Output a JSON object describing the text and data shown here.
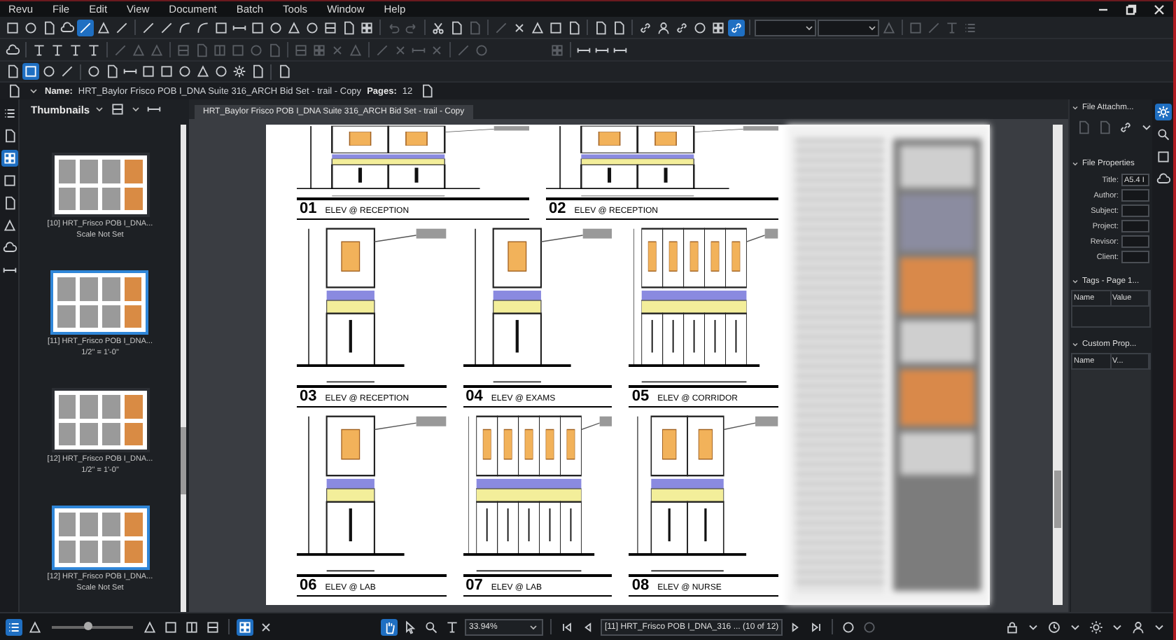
{
  "menu": [
    "Revu",
    "File",
    "Edit",
    "View",
    "Document",
    "Batch",
    "Tools",
    "Window",
    "Help"
  ],
  "file_info": {
    "name_label": "Name:",
    "name": "HRT_Baylor Frisco POB I_DNA Suite 316_ARCH Bid Set - trail - Copy",
    "pages_label": "Pages:",
    "pages": "12"
  },
  "thumbnails": {
    "title": "Thumbnails",
    "items": [
      {
        "label": "[10] HRT_Frisco POB I_DNA...",
        "scale": "Scale Not Set",
        "selected": false
      },
      {
        "label": "[11] HRT_Frisco POB I_DNA...",
        "scale": "1/2\" = 1'-0\"",
        "selected": true
      },
      {
        "label": "[12] HRT_Frisco POB I_DNA...",
        "scale": "1/2\" = 1'-0\"",
        "selected": false
      },
      {
        "label": "[12] HRT_Frisco POB I_DNA...",
        "scale": "Scale Not Set",
        "selected": true
      }
    ]
  },
  "document": {
    "tab": "HRT_Baylor Frisco POB I_DNA Suite 316_ARCH Bid Set - trail - Copy",
    "elevation_rows": [
      [
        {
          "number": "01",
          "title": "ELEV @ RECEPTION"
        },
        {
          "number": "02",
          "title": "ELEV @ RECEPTION"
        }
      ],
      [
        {
          "number": "03",
          "title": "ELEV @ RECEPTION"
        },
        {
          "number": "04",
          "title": "ELEV @ EXAMS"
        },
        {
          "number": "05",
          "title": "ELEV @ CORRIDOR"
        }
      ],
      [
        {
          "number": "06",
          "title": "ELEV @ LAB"
        },
        {
          "number": "07",
          "title": "ELEV @ LAB"
        },
        {
          "number": "08",
          "title": "ELEV @ NURSE"
        }
      ]
    ]
  },
  "right_panel": {
    "attachments": {
      "title": "File Attachm..."
    },
    "properties": {
      "title": "File Properties",
      "fields": [
        {
          "label": "Title:",
          "value": "A5.4 I"
        },
        {
          "label": "Author:"
        },
        {
          "label": "Subject:"
        },
        {
          "label": "Project:"
        },
        {
          "label": "Revisor:"
        },
        {
          "label": "Client:"
        }
      ]
    },
    "tags": {
      "title": "Tags - Page 1...",
      "columns": [
        "Name",
        "Value"
      ]
    },
    "custom": {
      "title": "Custom Prop...",
      "columns": [
        "Name",
        "V..."
      ]
    }
  },
  "status_bar": {
    "thumbnail_size": {
      "level": 0.45
    },
    "zoom": "33.94%",
    "page": "[11] HRT_Frisco POB I_DNA_316 ... (10 of 12)"
  }
}
